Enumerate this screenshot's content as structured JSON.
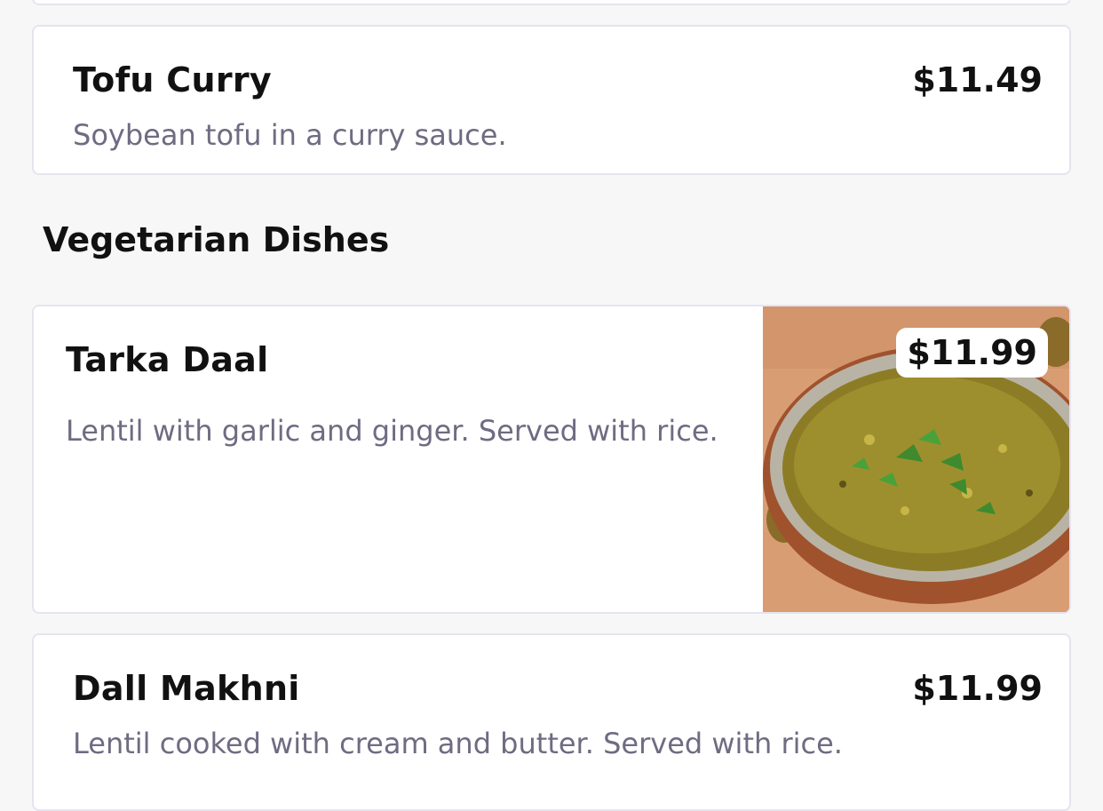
{
  "menu": {
    "items_above": [
      {
        "name": "Tofu Curry",
        "price": "$11.49",
        "description": "Soybean tofu in a curry sauce."
      }
    ],
    "section": {
      "title": "Vegetarian Dishes",
      "items": [
        {
          "name": "Tarka Daal",
          "price": "$11.99",
          "description": "Lentil with garlic and ginger. Served with rice.",
          "image": "bowl-of-lentil-curry"
        },
        {
          "name": "Dall Makhni",
          "price": "$11.99",
          "description": "Lentil cooked with cream and butter. Served with rice."
        }
      ]
    }
  },
  "colors": {
    "background": "#f7f7f7",
    "card": "#ffffff",
    "card_border": "#e6e4ef",
    "title_text": "#111111",
    "description_text": "#6f6b82"
  }
}
